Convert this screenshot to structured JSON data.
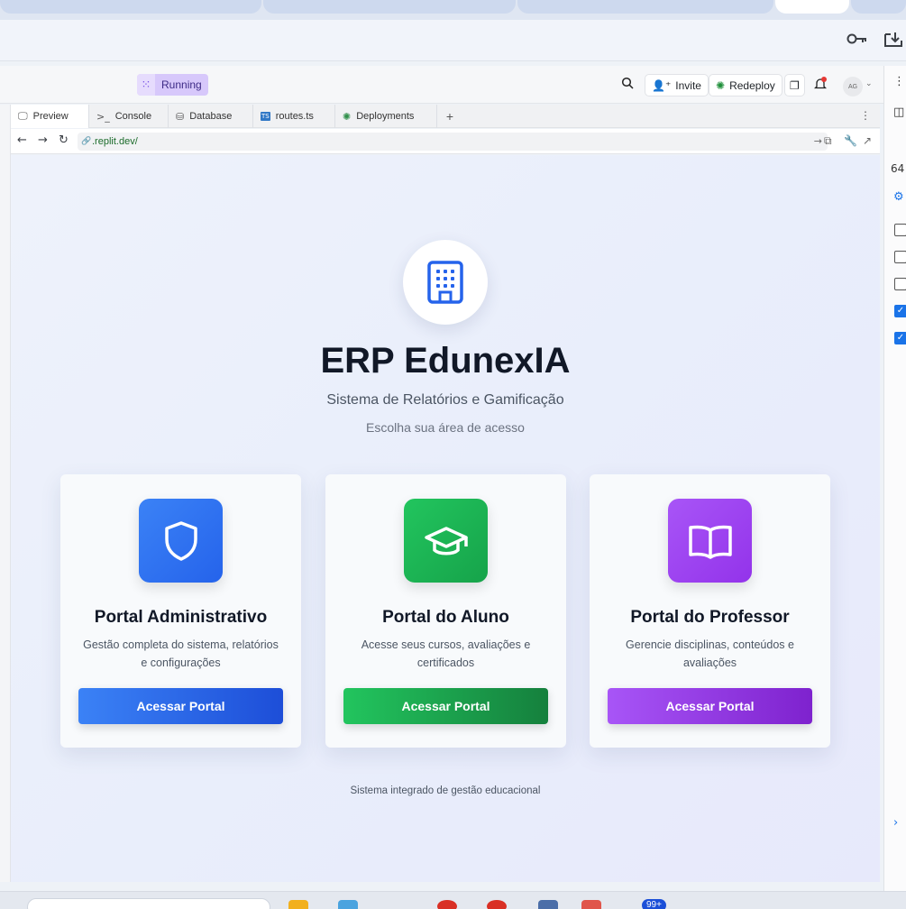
{
  "browser": {
    "toolbar_icons": [
      "key-icon",
      "download-icon"
    ]
  },
  "replit": {
    "status_label": "Running",
    "invite_label": "Invite",
    "redeploy_label": "Redeploy",
    "avatar_initials": "AG",
    "tabs": [
      {
        "label": "Preview",
        "icon": "monitor-icon"
      },
      {
        "label": "Console",
        "icon": "terminal-icon"
      },
      {
        "label": "Database",
        "icon": "database-icon"
      },
      {
        "label": "routes.ts",
        "icon": "typescript-file-icon"
      },
      {
        "label": "Deployments",
        "icon": "deploy-icon"
      }
    ],
    "url": ".replit.dev/"
  },
  "right_panel": {
    "number": "64"
  },
  "app": {
    "title": "ERP EdunexIA",
    "subtitle": "Sistema de Relatórios e Gamificação",
    "choose": "Escolha sua área de acesso",
    "footer": "Sistema integrado de gestão educacional",
    "cards": [
      {
        "title": "Portal Administrativo",
        "desc": "Gestão completa do sistema, relatórios e configurações",
        "button": "Acessar Portal",
        "icon": "shield-icon",
        "color": "#2563eb"
      },
      {
        "title": "Portal do Aluno",
        "desc": "Acesse seus cursos, avaliações e certificados",
        "button": "Acessar Portal",
        "icon": "graduation-cap-icon",
        "color": "#16a34a"
      },
      {
        "title": "Portal do Professor",
        "desc": "Gerencie disciplinas, conteúdos e avaliações",
        "button": "Acessar Portal",
        "icon": "book-open-icon",
        "color": "#9333ea"
      }
    ]
  },
  "taskbar": {
    "badge": "99+"
  }
}
